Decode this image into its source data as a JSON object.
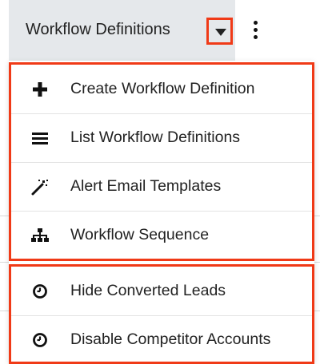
{
  "header": {
    "tab_label": "Workflow Definitions",
    "caret_icon": "caret-down-icon",
    "more_icon": "kebab-vertical-icon"
  },
  "menu": {
    "group_one": [
      {
        "label": "Create Workflow Definition",
        "icon": "plus-icon"
      },
      {
        "label": "List Workflow Definitions",
        "icon": "list-icon"
      },
      {
        "label": "Alert Email Templates",
        "icon": "magic-wand-icon"
      },
      {
        "label": "Workflow Sequence",
        "icon": "sitemap-icon"
      }
    ],
    "group_two": [
      {
        "label": "Hide Converted Leads",
        "icon": "clock-icon"
      },
      {
        "label": "Disable Competitor Accounts",
        "icon": "clock-icon"
      }
    ]
  },
  "colors": {
    "highlight": "#f03a17",
    "tab_bg": "#e5e8eb",
    "text": "#222222"
  }
}
